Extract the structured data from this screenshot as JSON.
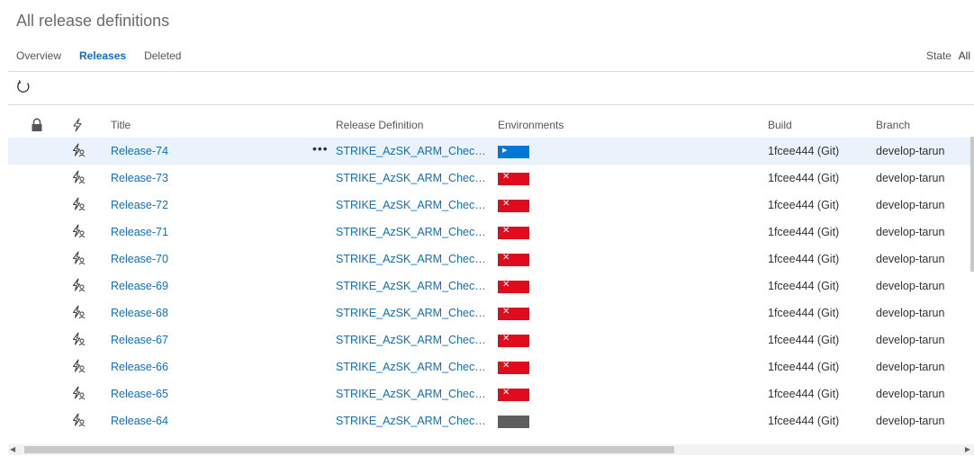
{
  "page": {
    "title": "All release definitions"
  },
  "tabs": [
    {
      "label": "Overview",
      "active": false
    },
    {
      "label": "Releases",
      "active": true
    },
    {
      "label": "Deleted",
      "active": false
    }
  ],
  "state_filter": {
    "label": "State",
    "value": "All"
  },
  "toolbar": {
    "refresh_icon": "refresh-icon"
  },
  "table": {
    "columns": {
      "lock_icon": "lock-icon",
      "trigger_icon": "lightning-icon",
      "title": "Title",
      "release_definition": "Release Definition",
      "environments": "Environments",
      "build": "Build",
      "branch": "Branch"
    },
    "rows": [
      {
        "title": "Release-74",
        "definition": "STRIKE_AzSK_ARM_Checker...",
        "env_status": "in-progress",
        "build": "1fcee444 (Git)",
        "branch": "develop-tarun"
      },
      {
        "title": "Release-73",
        "definition": "STRIKE_AzSK_ARM_Checker...",
        "env_status": "failed",
        "build": "1fcee444 (Git)",
        "branch": "develop-tarun"
      },
      {
        "title": "Release-72",
        "definition": "STRIKE_AzSK_ARM_Checker...",
        "env_status": "failed",
        "build": "1fcee444 (Git)",
        "branch": "develop-tarun"
      },
      {
        "title": "Release-71",
        "definition": "STRIKE_AzSK_ARM_Checker...",
        "env_status": "failed",
        "build": "1fcee444 (Git)",
        "branch": "develop-tarun"
      },
      {
        "title": "Release-70",
        "definition": "STRIKE_AzSK_ARM_Checker...",
        "env_status": "failed",
        "build": "1fcee444 (Git)",
        "branch": "develop-tarun"
      },
      {
        "title": "Release-69",
        "definition": "STRIKE_AzSK_ARM_Checker...",
        "env_status": "failed",
        "build": "1fcee444 (Git)",
        "branch": "develop-tarun"
      },
      {
        "title": "Release-68",
        "definition": "STRIKE_AzSK_ARM_Checker...",
        "env_status": "failed",
        "build": "1fcee444 (Git)",
        "branch": "develop-tarun"
      },
      {
        "title": "Release-67",
        "definition": "STRIKE_AzSK_ARM_Checker...",
        "env_status": "failed",
        "build": "1fcee444 (Git)",
        "branch": "develop-tarun"
      },
      {
        "title": "Release-66",
        "definition": "STRIKE_AzSK_ARM_Checker...",
        "env_status": "failed",
        "build": "1fcee444 (Git)",
        "branch": "develop-tarun"
      },
      {
        "title": "Release-65",
        "definition": "STRIKE_AzSK_ARM_Checker...",
        "env_status": "failed",
        "build": "1fcee444 (Git)",
        "branch": "develop-tarun"
      },
      {
        "title": "Release-64",
        "definition": "STRIKE_AzSK_ARM_Checker...",
        "env_status": "not-deployed",
        "build": "1fcee444 (Git)",
        "branch": "develop-tarun"
      }
    ],
    "more_actions_icon": "more-actions-icon"
  },
  "colors": {
    "accent": "#106ebe",
    "failed": "#e00b1c",
    "in_progress": "#0078d7",
    "not_deployed": "#5e5e5e",
    "selected_row": "#eaf2fb"
  }
}
